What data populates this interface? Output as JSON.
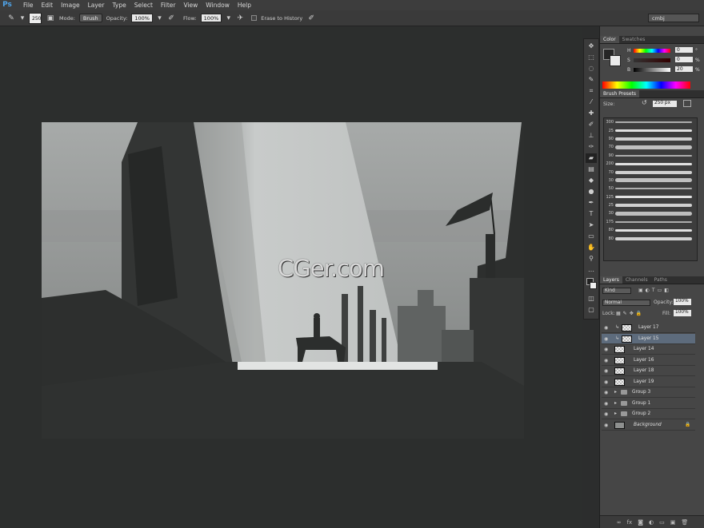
{
  "app": {
    "logo": "Ps"
  },
  "menu": [
    "File",
    "Edit",
    "Image",
    "Layer",
    "Type",
    "Select",
    "Filter",
    "View",
    "Window",
    "Help"
  ],
  "options": {
    "brush_size": "250",
    "mode_label": "Mode:",
    "mode_value": "Brush",
    "opacity_label": "Opacity:",
    "opacity_value": "100%",
    "flow_label": "Flow:",
    "flow_value": "100%",
    "erase_history": "Erase to History",
    "workspace": "cmbj"
  },
  "color_panel": {
    "tabs": [
      "Color",
      "Swatches"
    ],
    "h_label": "H",
    "h_value": "0",
    "h_unit": "°",
    "s_label": "S",
    "s_value": "0",
    "s_unit": "%",
    "b_label": "B",
    "b_value": "20",
    "b_unit": "%"
  },
  "brush_presets": {
    "tab": "Brush Presets",
    "size_label": "Size:",
    "size_value": "250 px",
    "brushes": [
      "300",
      "25",
      "90",
      "70",
      "90",
      "200",
      "70",
      "30",
      "50",
      "125",
      "25",
      "30",
      "175",
      "80",
      "80"
    ]
  },
  "layers_panel": {
    "tabs": [
      "Layers",
      "Channels",
      "Paths"
    ],
    "kind": "Kind",
    "blend_mode": "Normal",
    "opacity_label": "Opacity:",
    "opacity_value": "100%",
    "lock_label": "Lock:",
    "fill_label": "Fill:",
    "fill_value": "100%",
    "layers": [
      {
        "name": "Layer 17",
        "type": "clip"
      },
      {
        "name": "Layer 15",
        "type": "clip",
        "selected": true
      },
      {
        "name": "Layer 14",
        "type": "layer"
      },
      {
        "name": "Layer 16",
        "type": "layer"
      },
      {
        "name": "Layer 18",
        "type": "layer"
      },
      {
        "name": "Layer 19",
        "type": "layer"
      },
      {
        "name": "Group 3",
        "type": "group"
      },
      {
        "name": "Group 1",
        "type": "group"
      },
      {
        "name": "Group 2",
        "type": "group"
      },
      {
        "name": "Background",
        "type": "background"
      }
    ]
  },
  "watermark": "CGer.com"
}
